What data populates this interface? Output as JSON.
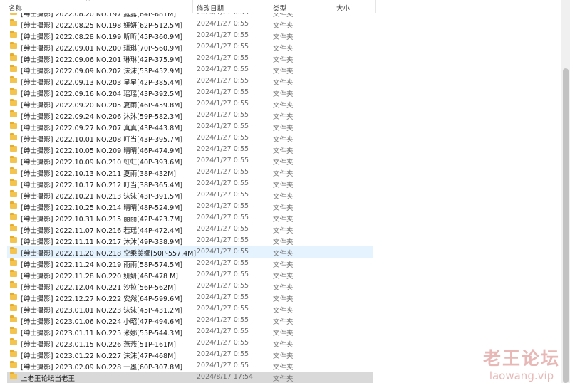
{
  "columns": {
    "name": "名称",
    "date": "修改日期",
    "type": "类型",
    "size": "大小"
  },
  "rows": [
    {
      "name": "[绅士摄影] 2022.08.20 NO.197 露露[64P-681M]",
      "date": "2024/1/27 0:55",
      "type": "文件夹"
    },
    {
      "name": "[绅士摄影] 2022.08.25 NO.198 妍妍[62P-512.5M]",
      "date": "2024/1/27 0:55",
      "type": "文件夹"
    },
    {
      "name": "[绅士摄影] 2022.08.28 NO.199 昕昕[45P-360.9M]",
      "date": "2024/1/27 0:55",
      "type": "文件夹"
    },
    {
      "name": "[绅士摄影] 2022.09.01 NO.200 琪琪[70P-560.9M]",
      "date": "2024/1/27 0:55",
      "type": "文件夹"
    },
    {
      "name": "[绅士摄影] 2022.09.06 NO.201 琳琳[42P-375.9M]",
      "date": "2024/1/27 0:55",
      "type": "文件夹"
    },
    {
      "name": "[绅士摄影] 2022.09.09 NO.202 沫沫[53P-452.9M]",
      "date": "2024/1/27 0:55",
      "type": "文件夹"
    },
    {
      "name": "[绅士摄影] 2022.09.13 NO.203 星星[42P-385.4M]",
      "date": "2024/1/27 0:55",
      "type": "文件夹"
    },
    {
      "name": "[绅士摄影] 2022.09.16 NO.204 瑶瑶[43P-392.5M]",
      "date": "2024/1/27 0:55",
      "type": "文件夹"
    },
    {
      "name": "[绅士摄影] 2022.09.20 NO.205 夏雨[46P-459.8M]",
      "date": "2024/1/27 0:55",
      "type": "文件夹"
    },
    {
      "name": "[绅士摄影] 2022.09.24 NO.206 沐沐[59P-582.3M]",
      "date": "2024/1/27 0:55",
      "type": "文件夹"
    },
    {
      "name": "[绅士摄影] 2022.09.27 NO.207 真真[43P-443.8M]",
      "date": "2024/1/27 0:55",
      "type": "文件夹"
    },
    {
      "name": "[绅士摄影] 2022.10.01 NO.208 叮当[43P-395.7M]",
      "date": "2024/1/27 0:55",
      "type": "文件夹"
    },
    {
      "name": "[绅士摄影] 2022.10.05 NO.209 晴晴[46P-474.9M]",
      "date": "2024/1/27 0:55",
      "type": "文件夹"
    },
    {
      "name": "[绅士摄影] 2022.10.09 NO.210 虹虹[40P-393.6M]",
      "date": "2024/1/27 0:55",
      "type": "文件夹"
    },
    {
      "name": "[绅士摄影] 2022.10.13 NO.211 夏雨[38P-432M]",
      "date": "2024/1/27 0:55",
      "type": "文件夹"
    },
    {
      "name": "[绅士摄影] 2022.10.17 NO.212 叮当[38P-365.4M]",
      "date": "2024/1/27 0:55",
      "type": "文件夹"
    },
    {
      "name": "[绅士摄影] 2022.10.21 NO.213 沫沫[43P-391.5M]",
      "date": "2024/1/27 0:55",
      "type": "文件夹"
    },
    {
      "name": "[绅士摄影] 2022.10.25 NO.214 晴晴[48P-524.9M]",
      "date": "2024/1/27 0:55",
      "type": "文件夹"
    },
    {
      "name": "[绅士摄影] 2022.10.31 NO.215 丽丽[42P-423.7M]",
      "date": "2024/1/27 0:55",
      "type": "文件夹"
    },
    {
      "name": "[绅士摄影] 2022.11.07 NO.216 若瑶[44P-472.4M]",
      "date": "2024/1/27 0:55",
      "type": "文件夹"
    },
    {
      "name": "[绅士摄影] 2022.11.11 NO.217 沐沐[49P-338.9M]",
      "date": "2024/1/27 0:55",
      "type": "文件夹"
    },
    {
      "name": "[绅士摄影] 2022.11.20 NO.218 空乘美娜[50P-557.4M]",
      "date": "2024/1/27 0:55",
      "type": "文件夹"
    },
    {
      "name": "[绅士摄影] 2022.11.24 NO.219 雨雨[58P-574.5M]",
      "date": "2024/1/27 0:55",
      "type": "文件夹"
    },
    {
      "name": "[绅士摄影] 2022.11.28 NO.220 妍妍[46P-478 M]",
      "date": "2024/1/27 0:55",
      "type": "文件夹"
    },
    {
      "name": "[绅士摄影] 2022.12.04 NO.221 沙拉[56P-562M]",
      "date": "2024/1/27 0:55",
      "type": "文件夹"
    },
    {
      "name": "[绅士摄影] 2022.12.27 NO.222 安然[64P-599.6M]",
      "date": "2024/1/27 0:55",
      "type": "文件夹"
    },
    {
      "name": "[绅士摄影] 2023.01.01 NO.223 沫沫[45P-431.2M]",
      "date": "2024/1/27 0:55",
      "type": "文件夹"
    },
    {
      "name": "[绅士摄影] 2023.01.06 NO.224 小昭[47P-494.6M]",
      "date": "2024/1/27 0:55",
      "type": "文件夹"
    },
    {
      "name": "[绅士摄影] 2023.01.11 NO.225 米娜[55P-544.3M]",
      "date": "2024/1/27 0:55",
      "type": "文件夹"
    },
    {
      "name": "[绅士摄影] 2023.01.15 NO.226 燕燕[51P-161M]",
      "date": "2024/1/27 0:55",
      "type": "文件夹"
    },
    {
      "name": "[绅士摄影] 2023.01.22 NO.227 沫沫[47P-468M]",
      "date": "2024/1/27 0:55",
      "type": "文件夹"
    },
    {
      "name": "[绅士摄影] 2023.02.09 NO.228 一墨[60P-307.8M]",
      "date": "2024/1/27 0:55",
      "type": "文件夹"
    },
    {
      "name": "上老王论坛当老王",
      "date": "2024/8/17 17:54",
      "type": "文件夹"
    }
  ],
  "selected_row_index": 21,
  "hover_row_index": 32,
  "watermark": {
    "line1": "老王论坛",
    "line2": "laowang.vip"
  },
  "colors": {
    "folder": "#f3c44f",
    "selected_bg": "#e5f3ff",
    "hover_bg": "#d9d9d9",
    "watermark": "#e7b8b6"
  }
}
